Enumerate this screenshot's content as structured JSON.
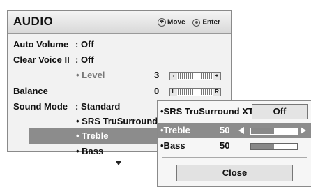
{
  "menu": {
    "title": "AUDIO",
    "hint_move": "Move",
    "hint_enter": "Enter",
    "rows": {
      "auto_volume": {
        "label": "Auto Volume",
        "value": ": Off"
      },
      "clear_voice": {
        "label": "Clear Voice II",
        "value": ": Off"
      },
      "level": {
        "label": "• Level",
        "value": "3",
        "slider_left": "-",
        "slider_right": "+"
      },
      "balance": {
        "label": "Balance",
        "value": "0",
        "slider_left": "L",
        "slider_right": "R"
      },
      "sound_mode": {
        "label": "Sound Mode",
        "value": ": Standard"
      },
      "srs": {
        "label": "• SRS TruSurround"
      },
      "treble": {
        "label": "• Treble"
      },
      "bass": {
        "label": "• Bass"
      }
    }
  },
  "popup": {
    "srs": {
      "label": "•SRS TruSurround XT",
      "value": "Off"
    },
    "treble": {
      "label": "•Treble",
      "value": "50",
      "level": 0.5
    },
    "bass": {
      "label": "•Bass",
      "value": "50",
      "level": 0.5
    },
    "close_label": "Close"
  },
  "colors": {
    "selection": "#8c8c8c",
    "panel": "#f2f2f2"
  }
}
